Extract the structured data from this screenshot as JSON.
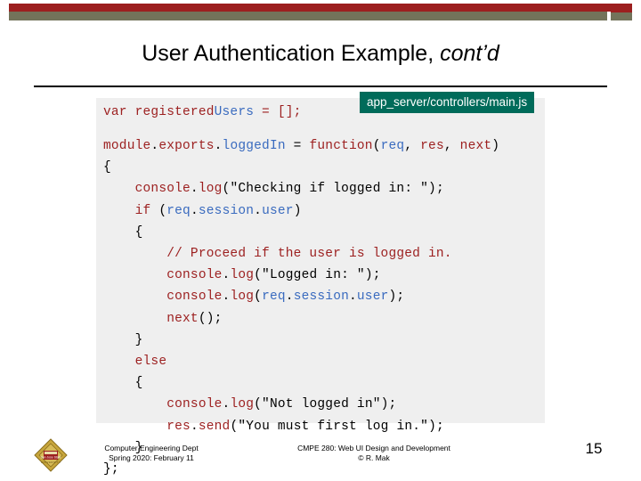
{
  "slide": {
    "title_main": "User Authentication Example, ",
    "title_italic": "cont’d",
    "page_number": "15"
  },
  "code": {
    "filename_label": "app_server/controllers/main.js",
    "first_line_pre": "var registered",
    "first_line_mid": "Users",
    "first_line_post": " = [];",
    "lines": [
      "module.exports.loggedIn = function(req, res, next)",
      "{",
      "    console.log(\"Checking if logged in: \");",
      "    if (req.session.user)",
      "    {",
      "        // Proceed if the user is logged in.",
      "        console.log(\"Logged in: \");",
      "        console.log(req.session.user);",
      "        next();",
      "    }",
      "    else",
      "    {",
      "        console.log(\"Not logged in\");",
      "        res.send(\"You must first log in.\");",
      "    }",
      "};"
    ]
  },
  "footer": {
    "left_line1": "Computer Engineering Dept",
    "left_line2": "Spring 2020: February 11",
    "center_line1": "CMPE 280: Web UI Design and Development",
    "center_line2": "© R. Mak",
    "logo_text": "San Jose State UNIVERSITY"
  },
  "colors": {
    "accent_red": "#9c1f1f",
    "accent_olive": "#73735a",
    "callout_green": "#006b5a",
    "code_bg": "#efefef",
    "code_keyword": "#9c1f1f",
    "code_ident": "#3a6bbf"
  }
}
